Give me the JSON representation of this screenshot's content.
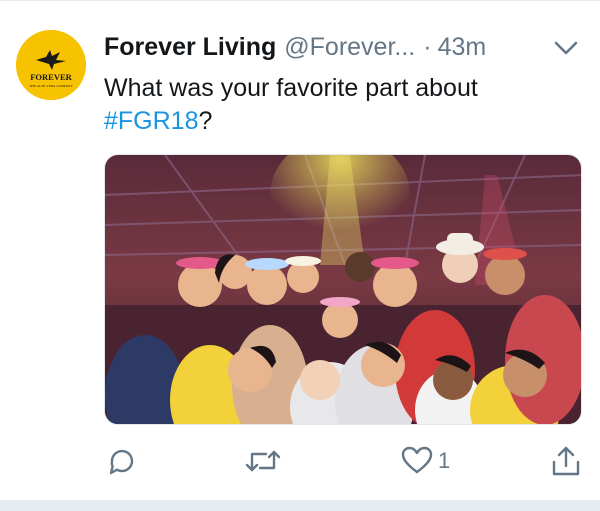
{
  "tweet": {
    "author_name": "Forever Living",
    "author_handle": "@Forever...",
    "separator": "·",
    "timestamp": "43m",
    "text_before": "What was your favorite part about ",
    "hashtag": "#FGR18",
    "text_after": "?",
    "avatar": {
      "logo_text": "FOREVER",
      "logo_subtext": "THE ALOE VERA COMPANY",
      "background": "#f7c200"
    },
    "media": {
      "alt": "Group photo of smiling people at a concert event"
    }
  },
  "actions": {
    "reply_icon": "reply-icon",
    "retweet_icon": "retweet-icon",
    "like_icon": "heart-icon",
    "like_count": "1",
    "share_icon": "share-icon"
  },
  "menu_icon": "chevron-down-icon",
  "colors": {
    "link": "#1b95e0",
    "secondary_text": "#657786",
    "primary_text": "#14171a",
    "divider": "#e6ecf0"
  }
}
